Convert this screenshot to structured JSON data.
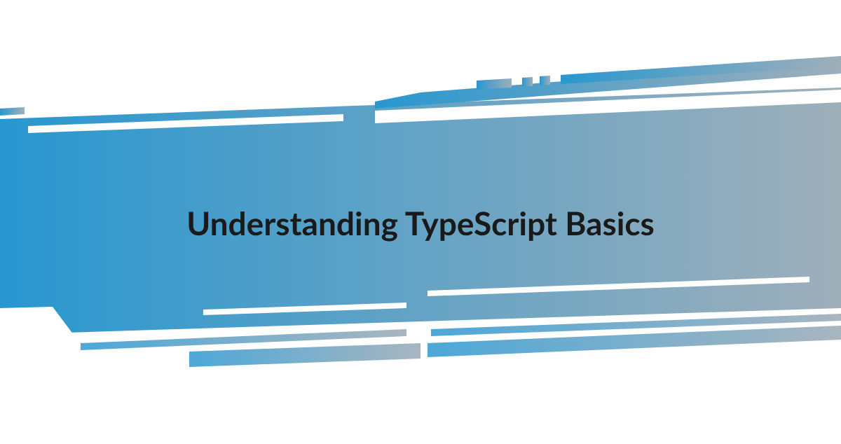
{
  "title": "Understanding TypeScript Basics",
  "colors": {
    "gradient_start": "#2897d0",
    "gradient_end": "#9fafba",
    "accent_dark": "#1a1a1a"
  }
}
